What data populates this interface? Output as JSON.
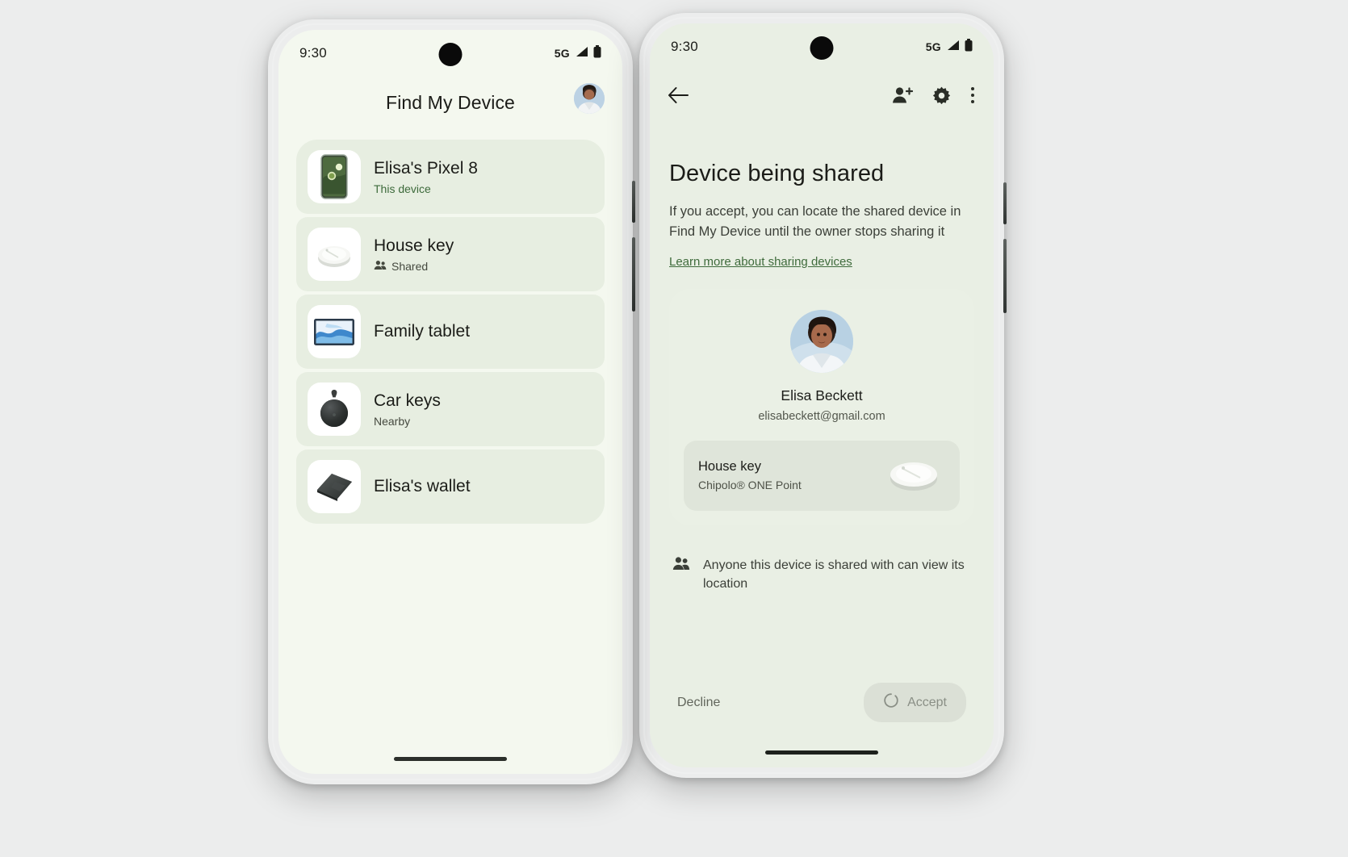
{
  "left_phone": {
    "status": {
      "clock": "9:30",
      "network": "5G",
      "signal_icon": "signal-bars-icon",
      "battery_icon": "battery-full-icon"
    },
    "appbar": {
      "title": "Find My Device",
      "avatar_icon": "account-avatar"
    },
    "devices": [
      {
        "name": "Elisa's Pixel 8",
        "subtitle": "This device",
        "subtitle_icon": "",
        "thumb_icon": "phone-thumbnail",
        "sub_style": "green"
      },
      {
        "name": "House key",
        "subtitle": "Shared",
        "subtitle_icon": "people-icon",
        "thumb_icon": "tracker-tag-round-thumbnail",
        "sub_style": "grey"
      },
      {
        "name": "Family tablet",
        "subtitle": "",
        "subtitle_icon": "",
        "thumb_icon": "tablet-thumbnail",
        "sub_style": "grey"
      },
      {
        "name": "Car keys",
        "subtitle": "Nearby",
        "subtitle_icon": "",
        "thumb_icon": "tracker-tag-teardrop-thumbnail",
        "sub_style": "grey"
      },
      {
        "name": "Elisa's wallet",
        "subtitle": "",
        "subtitle_icon": "",
        "thumb_icon": "wallet-thumbnail",
        "sub_style": "grey"
      }
    ]
  },
  "right_phone": {
    "status": {
      "clock": "9:30",
      "network": "5G",
      "signal_icon": "signal-bars-icon",
      "battery_icon": "battery-full-icon"
    },
    "appbar": {
      "back_icon": "arrow-left-icon",
      "add_person_icon": "person-add-icon",
      "settings_icon": "gear-icon",
      "overflow_icon": "more-vert-icon"
    },
    "headline": "Device being shared",
    "body": "If you accept, you can locate the shared device in Find My Device until the owner stops sharing it",
    "link": "Learn more about sharing devices",
    "owner": {
      "avatar_icon": "owner-avatar",
      "name": "Elisa Beckett",
      "email": "elisabeckett@gmail.com"
    },
    "shared_item": {
      "title": "House key",
      "subtitle": "Chipolo® ONE Point",
      "thumb_icon": "tracker-tag-round-thumbnail"
    },
    "note": {
      "icon": "people-icon",
      "text": "Anyone this device is shared with can view its location"
    },
    "actions": {
      "decline_label": "Decline",
      "accept_label": "Accept",
      "accept_spinner_icon": "loading-spinner-icon"
    }
  },
  "colors": {
    "page_background": "#eceded",
    "screen_left_bg": "#f4f8ef",
    "screen_right_bg": "#e9efe4",
    "card_bg": "#e7eee1",
    "link_green": "#3f6b3c",
    "text_primary": "#1b1c18",
    "text_secondary": "#4d5147",
    "accept_btn_bg": "#dbe0d6"
  }
}
